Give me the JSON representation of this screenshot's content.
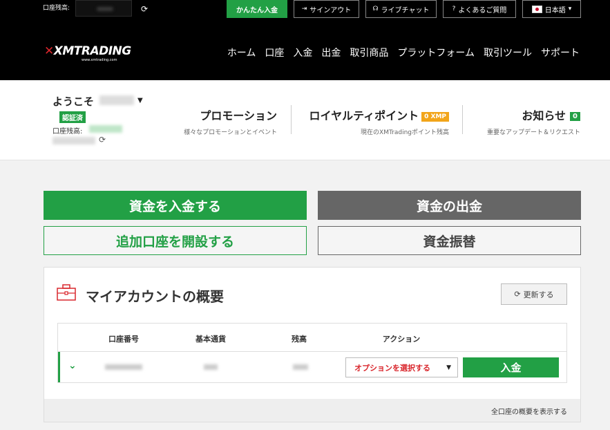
{
  "topbar": {
    "balance_label": "口座残高:",
    "quick_deposit": "かんたん入金",
    "signout": "サインアウト",
    "livechat": "ライブチャット",
    "faq": "よくあるご質問",
    "language": "日本語"
  },
  "nav": {
    "logo": "XMTRADING",
    "logo_sub": "www.xmtrading.com",
    "items": [
      "ホーム",
      "口座",
      "入金",
      "出金",
      "取引商品",
      "プラットフォーム",
      "取引ツール",
      "サポート"
    ]
  },
  "welcome": {
    "greeting": "ようこそ",
    "verified": "認証済",
    "balance_label": "口座残高: "
  },
  "promos": {
    "promotion_title": "プロモーション",
    "promotion_sub": "様々なプロモーションとイベント",
    "loyalty_title": "ロイヤルティポイント",
    "loyalty_badge": "0 XMP",
    "loyalty_sub": "現在のXMTradingポイント残高",
    "news_title": "お知らせ",
    "news_badge": "0",
    "news_sub": "重要なアップデート＆リクエスト"
  },
  "actions": {
    "deposit": "資金を入金する",
    "withdraw": "資金の出金",
    "open_account": "追加口座を開設する",
    "transfer": "資金振替"
  },
  "overview": {
    "title": "マイアカウントの概要",
    "refresh": "更新する",
    "columns": [
      "口座番号",
      "基本通貨",
      "残高",
      "アクション"
    ],
    "option_select": "オプションを選択する",
    "deposit_button": "入金",
    "view_all": "全口座の概要を表示する"
  },
  "colors": {
    "accent_green": "#22a045",
    "brand_red": "#d9262c",
    "xmp_orange": "#f2a51a"
  }
}
